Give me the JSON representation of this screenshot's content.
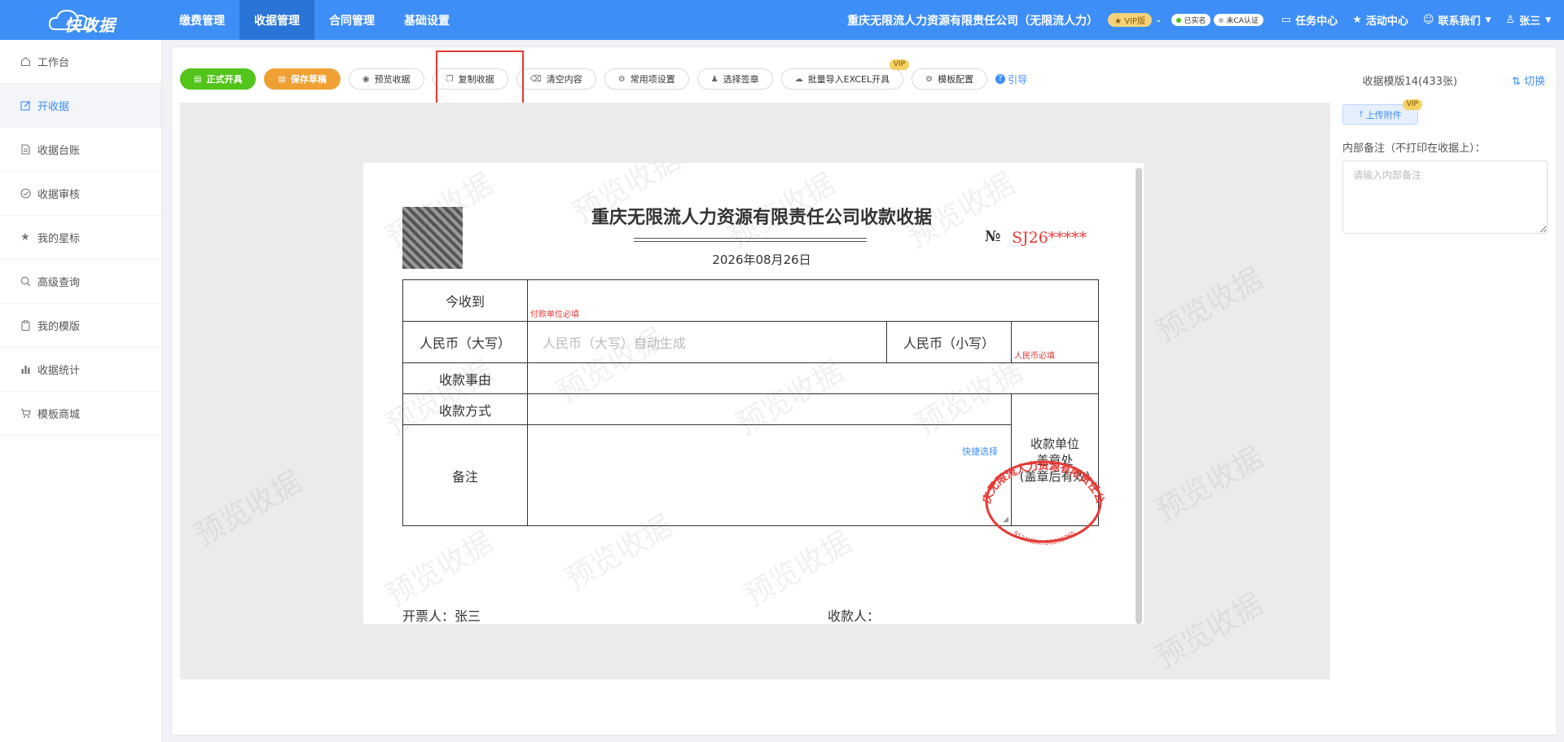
{
  "app": {
    "logo_text": "快收据",
    "brand_color": "#3e8ef7"
  },
  "topnav": {
    "items": [
      {
        "label": "缴费管理",
        "active": false
      },
      {
        "label": "收据管理",
        "active": true
      },
      {
        "label": "合同管理",
        "active": false
      },
      {
        "label": "基础设置",
        "active": false
      }
    ]
  },
  "topright": {
    "company": "重庆无限流人力资源有限责任公司（无限流人力）",
    "vip_label": "★ VIP版",
    "verified_label": "已实名",
    "ca_label": "未CA认证",
    "task_center": "任务中心",
    "activity_center": "活动中心",
    "contact_us": "联系我们",
    "user_name": "张三"
  },
  "sidebar": {
    "items": [
      {
        "label": "工作台",
        "icon": "home-icon",
        "active": false
      },
      {
        "label": "开收据",
        "icon": "edit-icon",
        "active": true
      },
      {
        "label": "收据台账",
        "icon": "document-icon",
        "active": false
      },
      {
        "label": "收据审核",
        "icon": "check-circle-icon",
        "active": false
      },
      {
        "label": "我的星标",
        "icon": "star-icon",
        "active": false
      },
      {
        "label": "高级查询",
        "icon": "search-icon",
        "active": false
      },
      {
        "label": "我的模版",
        "icon": "clipboard-icon",
        "active": false
      },
      {
        "label": "收据统计",
        "icon": "bar-chart-icon",
        "active": false
      },
      {
        "label": "模板商城",
        "icon": "cart-icon",
        "active": false
      }
    ]
  },
  "toolbar": {
    "issue": "正式开具",
    "save_draft": "保存草稿",
    "preview": "预览收据",
    "copy": "复制收据",
    "clear": "清空内容",
    "common_settings": "常用项设置",
    "select_seal": "选择签章",
    "batch_import": "批量导入EXCEL开具",
    "vip_badge": "VIP",
    "template_config": "模板配置",
    "guide": "引导"
  },
  "template_info": "收据模版14(433张)",
  "switch_label": "切换",
  "receipt": {
    "watermark": "预览收据",
    "title": "重庆无限流人力资源有限责任公司收款收据",
    "date": "2026年08月26日",
    "no_label": "№",
    "no_value": "SJ26*****",
    "rows": {
      "received_from": "今收到",
      "received_from_hint": "付款单位必填",
      "rmb_upper": "人民币（大写）",
      "rmb_upper_placeholder": "人民币（大写）自动生成",
      "rmb_lower": "人民币（小写）",
      "rmb_lower_hint": "人民币必填",
      "reason": "收款事由",
      "method": "收款方式",
      "remark": "备注",
      "quick_select": "快捷选择"
    },
    "stamp_cell": {
      "line1": "收款单位",
      "line2": "盖章处",
      "line3": "(盖章后有效)"
    },
    "stamp": {
      "company": "重庆无限流人力资源有限责任公司",
      "code": "9134KOKH98098765",
      "color": "#e53935"
    },
    "issuer_label": "开票人：张三",
    "payee_label": "收款人："
  },
  "right_panel": {
    "upload": "上传附件",
    "vip_badge": "VIP",
    "note_label": "内部备注（不打印在收据上）：",
    "note_placeholder": "请输入内部备注"
  }
}
